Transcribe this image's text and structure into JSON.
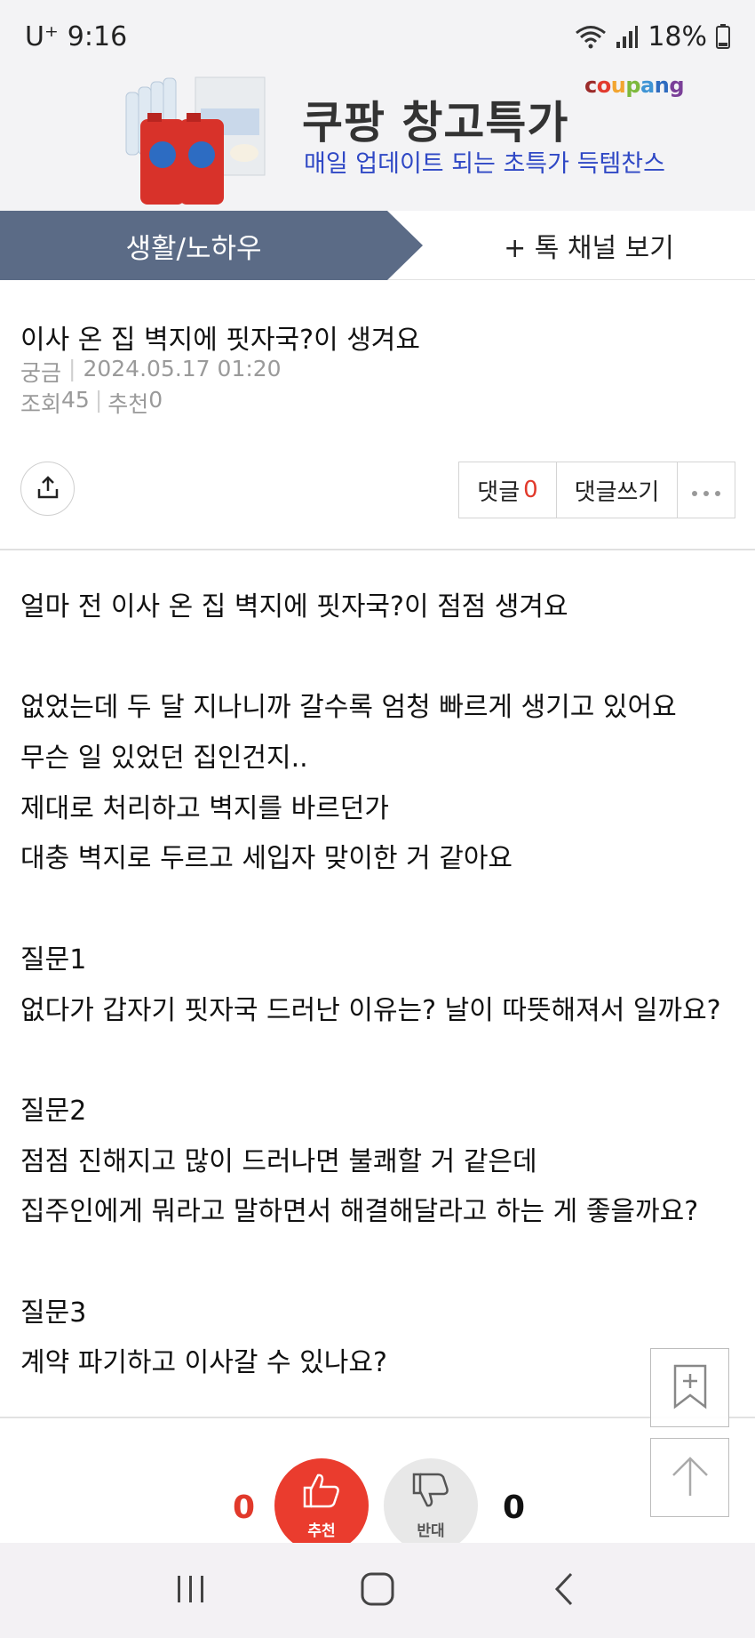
{
  "status_bar": {
    "carrier": "U⁺",
    "time": "9:16",
    "battery": "18%"
  },
  "ad": {
    "title": "쿠팡 창고특가",
    "subtitle": "매일 업데이트 되는 초특가 득템찬스",
    "brand_letters": [
      "c",
      "o",
      "u",
      "p",
      "a",
      "n",
      "g"
    ],
    "brand_colors": [
      "#9b2b2a",
      "#e23b2f",
      "#f2a531",
      "#7db93c",
      "#3f94d4",
      "#2e6bbf",
      "#7a3f98"
    ]
  },
  "tabs": {
    "active_label": "생활/노하우",
    "channel_label": "+ 톡 채널 보기",
    "active_color": "#5b6b86"
  },
  "post": {
    "title": "이사 온 집 벽지에 핏자국?이 생겨요",
    "category": "궁금",
    "datetime": "2024.05.17 01:20",
    "views_label": "조회",
    "views": "45",
    "recommend_label": "추천",
    "recommend": "0"
  },
  "actions": {
    "comments_label": "댓글",
    "comments_count": "0",
    "write_label": "댓글쓰기"
  },
  "body_lines": [
    "얼마 전 이사 온 집 벽지에 핏자국?이 점점 생겨요",
    "",
    "없었는데 두 달 지나니까 갈수록 엄청 빠르게 생기고 있어요",
    "무슨 일 있었던 집인건지..",
    "제대로 처리하고 벽지를 바르던가",
    "대충 벽지로 두르고 세입자 맞이한 거 같아요",
    "",
    "질문1",
    "없다가 갑자기 핏자국 드러난 이유는? 날이 따뜻해져서 일까요?",
    "",
    "질문2",
    "점점 진해지고 많이 드러나면 불쾌할 거 같은데",
    "집주인에게 뭐라고 말하면서 해결해달라고 하는 게 좋을까요?",
    "",
    "질문3",
    "계약 파기하고 이사갈 수 있나요?"
  ],
  "vote": {
    "up_count": "0",
    "up_label": "추천",
    "down_count": "0",
    "down_label": "반대"
  }
}
